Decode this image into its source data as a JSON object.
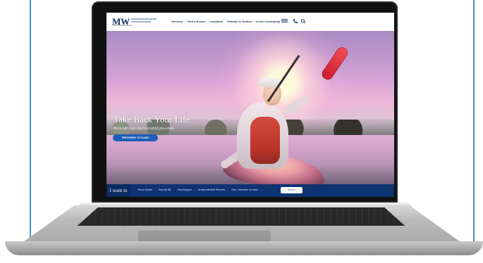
{
  "header": {
    "logo_mark": "MW",
    "nav_items": [
      "Services",
      "Find a Doctor",
      "Locations",
      "Patients & Visitors",
      "In the Community"
    ]
  },
  "hero": {
    "headline": "Take Back Your Life",
    "subhead": "Back pain can interrupt what you enjoy",
    "cta_label": "TREATMENT AT CLINIC",
    "carousel_prev": "‹",
    "carousel_next": "›"
  },
  "bottom_bar": {
    "iwant": "I want to",
    "links": [
      "Find a Doctor",
      "Pay My Bill",
      "Help Support",
      "Access Medical Records",
      "Give, Volunteer or Learn"
    ],
    "search_label": "Search"
  },
  "icons": {
    "menu": "menu-icon",
    "phone": "phone-icon",
    "search": "search-icon",
    "prev": "chevron-left-icon",
    "next": "chevron-right-icon"
  },
  "colors": {
    "brand_navy": "#0f3371",
    "cta_blue": "#1c5eb6",
    "frame_blue": "#4a90d9"
  }
}
